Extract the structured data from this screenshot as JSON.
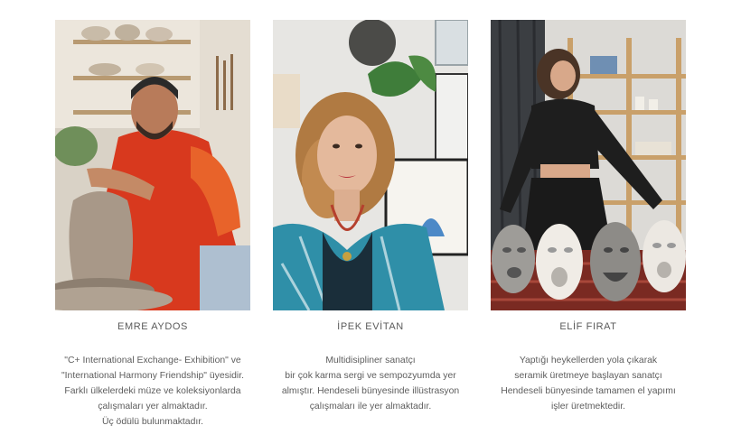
{
  "artists": [
    {
      "name": "EMRE AYDOS",
      "photo_subject": "potter-at-wheel",
      "bio": [
        "\"C+ International Exchange- Exhibition\" ve",
        "\"International Harmony Friendship\" üyesidir.",
        "Farklı ülkelerdeki müze ve koleksiyonlarda",
        "çalışmaları yer almaktadır.",
        "Üç ödülü bulunmaktadır."
      ]
    },
    {
      "name": "İPEK EVİTAN",
      "photo_subject": "illustrator-portrait",
      "bio": [
        "Multidisipliner sanatçı",
        "bir çok karma sergi ve sempozyumda yer",
        "almıştır. Hendeseli bünyesinde illüstrasyon",
        "çalışmaları ile yer almaktadır."
      ]
    },
    {
      "name": "ELİF FIRAT",
      "photo_subject": "sculptor-with-ceramic-faces",
      "bio": [
        "Yaptığı heykellerden yola çıkarak",
        "seramik üretmeye başlayan sanatçı",
        "Hendeseli bünyesinde tamamen el yapımı",
        "işler üretmektedir."
      ]
    }
  ]
}
